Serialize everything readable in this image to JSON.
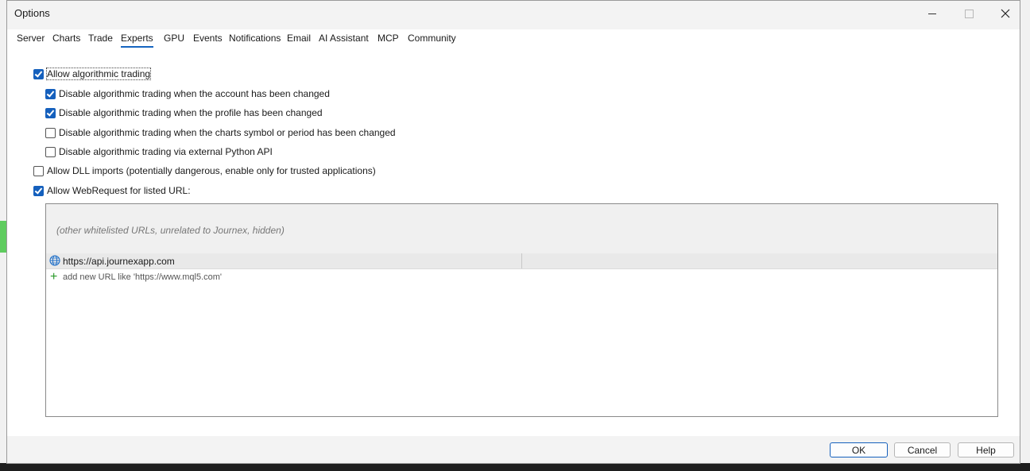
{
  "window": {
    "title": "Options"
  },
  "tabs": [
    {
      "label": "Server"
    },
    {
      "label": "Charts"
    },
    {
      "label": "Trade"
    },
    {
      "label": "Experts"
    },
    {
      "label": "GPU"
    },
    {
      "label": "Events"
    },
    {
      "label": "Notifications"
    },
    {
      "label": "Email"
    },
    {
      "label": "AI Assistant"
    },
    {
      "label": "MCP"
    },
    {
      "label": "Community"
    }
  ],
  "active_tab": "Experts",
  "experts": {
    "allow_algo": {
      "label": "Allow algorithmic trading",
      "checked": true
    },
    "disable_account": {
      "label": "Disable algorithmic trading when the account has been changed",
      "checked": true
    },
    "disable_profile": {
      "label": "Disable algorithmic trading when the profile has been changed",
      "checked": true
    },
    "disable_symbol": {
      "label": "Disable algorithmic trading when the charts symbol or period has been changed",
      "checked": false
    },
    "disable_python": {
      "label": "Disable algorithmic trading via external Python API",
      "checked": false
    },
    "allow_dll": {
      "label": "Allow DLL imports (potentially dangerous, enable only for trusted applications)",
      "checked": false
    },
    "allow_webrequest": {
      "label": "Allow WebRequest for listed URL:",
      "checked": true
    }
  },
  "url_list": {
    "hidden_note": "(other whitelisted URLs, unrelated to Journex, hidden)",
    "urls": [
      {
        "url": "https://api.journexapp.com"
      }
    ],
    "add_placeholder": "add new URL like 'https://www.mql5.com'"
  },
  "buttons": {
    "ok": "OK",
    "cancel": "Cancel",
    "help": "Help"
  },
  "colors": {
    "accent": "#1560bd",
    "add_icon": "#2a9a2a"
  }
}
